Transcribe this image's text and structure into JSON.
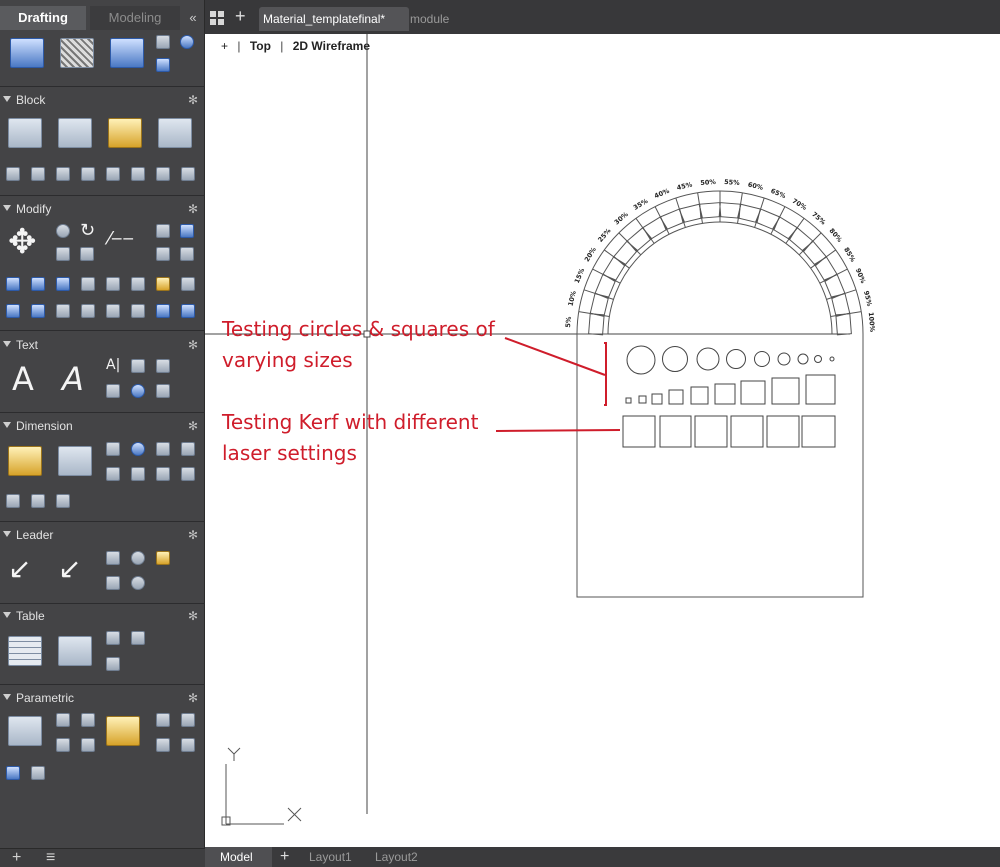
{
  "workspace_tabs": {
    "drafting": "Drafting",
    "modeling": "Modeling",
    "collapse": "«"
  },
  "document_tabs": {
    "active": "Material_templatefinal*",
    "inactive": "module",
    "new_tab": "+"
  },
  "palette_sections": {
    "block": "Block",
    "modify": "Modify",
    "text": "Text",
    "dimension": "Dimension",
    "leader": "Leader",
    "table": "Table",
    "parametric": "Parametric"
  },
  "viewport": {
    "plus": "+",
    "view": "Top",
    "style": "2D Wireframe"
  },
  "annotations": {
    "circles_line1": "Testing circles & squares of",
    "circles_line2": "varying sizes",
    "kerf_line1": "Testing Kerf with different",
    "kerf_line2": "laser settings"
  },
  "arch_labels": [
    "5%",
    "10%",
    "15%",
    "20%",
    "25%",
    "30%",
    "35%",
    "40%",
    "45%",
    "50%",
    "55%",
    "60%",
    "65%",
    "70%",
    "75%",
    "80%",
    "85%",
    "90%",
    "95%",
    "100%"
  ],
  "ucs": {
    "y": "Y",
    "x": "X"
  },
  "layout_tabs": {
    "model": "Model",
    "add": "+",
    "layout1": "Layout1",
    "layout2": "Layout2"
  },
  "colors": {
    "annotation": "#cf1d2b",
    "canvas": "#ffffff",
    "palette": "#444446"
  }
}
